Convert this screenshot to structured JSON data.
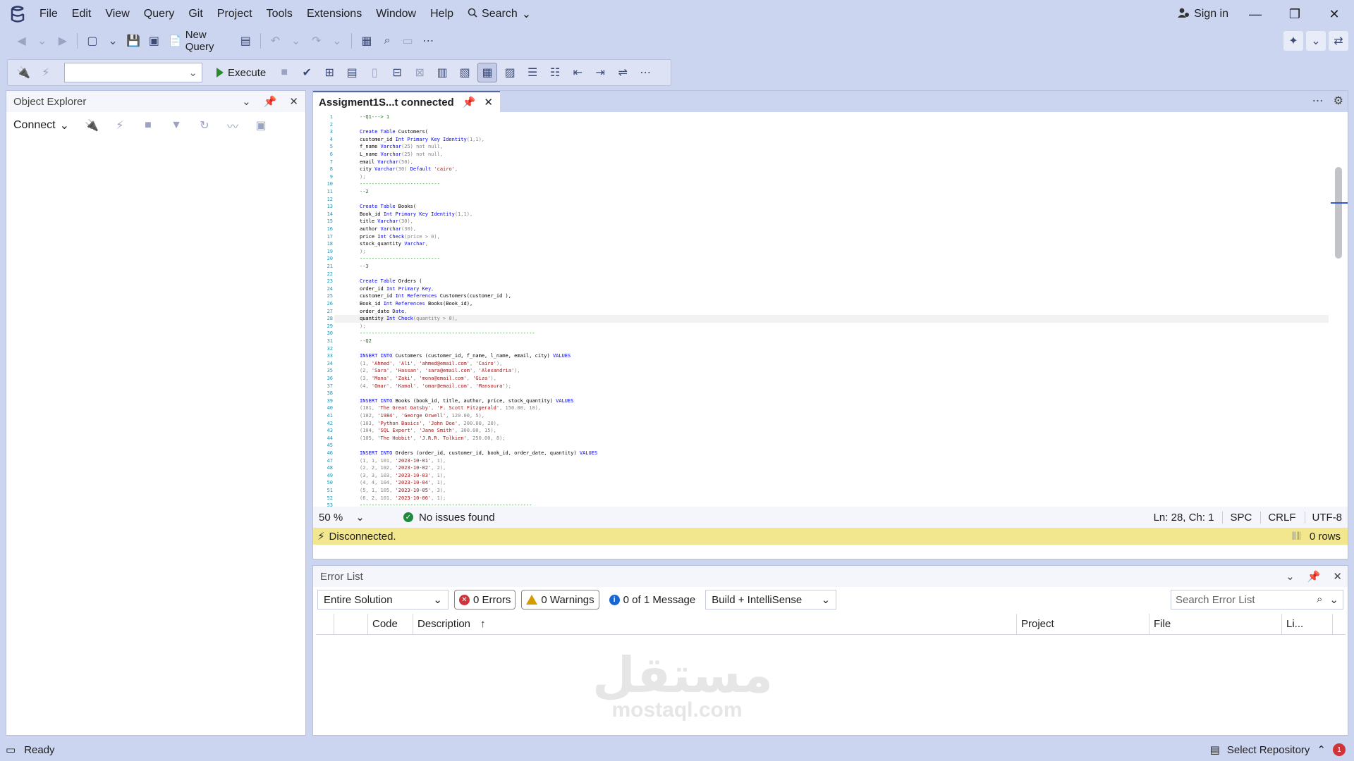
{
  "menu": {
    "items": [
      "File",
      "Edit",
      "View",
      "Query",
      "Git",
      "Project",
      "Tools",
      "Extensions",
      "Window",
      "Help"
    ],
    "search_label": "Search",
    "sign_in_label": "Sign in"
  },
  "toolbar": {
    "new_query_label": "New Query",
    "execute_label": "Execute",
    "database_value": ""
  },
  "object_explorer": {
    "title": "Object Explorer",
    "connect_label": "Connect"
  },
  "editor": {
    "tab_title": "Assigment1S...t connected",
    "zoom": "50 %",
    "issues": "No issues found",
    "position": "Ln: 28, Ch: 1",
    "whitespace": "SPC",
    "line_ending": "CRLF",
    "encoding": "UTF-8",
    "connection_status": "Disconnected.",
    "rows": "0 rows",
    "current_line": 28,
    "lines": [
      [
        [
          "c",
          "--Q1---> 1"
        ]
      ],
      [],
      [
        [
          "k",
          "Create Table "
        ],
        [
          "t",
          "Customers("
        ]
      ],
      [
        [
          "t",
          "customer_id "
        ],
        [
          "k",
          "Int Primary Key Identity"
        ],
        [
          "g",
          "(1,1),"
        ]
      ],
      [
        [
          "t",
          "f_name "
        ],
        [
          "k",
          "Varchar"
        ],
        [
          "g",
          "(25) not null,"
        ]
      ],
      [
        [
          "t",
          "L_name "
        ],
        [
          "k",
          "Varchar"
        ],
        [
          "g",
          "(25) not null,"
        ]
      ],
      [
        [
          "t",
          "email "
        ],
        [
          "k",
          "Varchar"
        ],
        [
          "g",
          "(50),"
        ]
      ],
      [
        [
          "t",
          "city "
        ],
        [
          "k",
          "Varchar"
        ],
        [
          "g",
          "(30) "
        ],
        [
          "k",
          "Default "
        ],
        [
          "s",
          "'cairo'"
        ],
        [
          "g",
          ","
        ]
      ],
      [
        [
          "g",
          ");"
        ]
      ],
      [
        [
          "c",
          "---------------------------"
        ]
      ],
      [
        [
          "c",
          "--2"
        ]
      ],
      [],
      [
        [
          "k",
          "Create Table "
        ],
        [
          "t",
          "Books("
        ]
      ],
      [
        [
          "t",
          "Book_id "
        ],
        [
          "k",
          "Int Primary Key Identity"
        ],
        [
          "g",
          "(1,1),"
        ]
      ],
      [
        [
          "t",
          "title "
        ],
        [
          "k",
          "Varchar"
        ],
        [
          "g",
          "(30),"
        ]
      ],
      [
        [
          "t",
          "author "
        ],
        [
          "k",
          "Varchar"
        ],
        [
          "g",
          "(30),"
        ]
      ],
      [
        [
          "t",
          "price "
        ],
        [
          "k",
          "Int Check"
        ],
        [
          "g",
          "(price > 0),"
        ]
      ],
      [
        [
          "t",
          "stock_quantity "
        ],
        [
          "k",
          "Varchar"
        ],
        [
          "g",
          ","
        ]
      ],
      [
        [
          "g",
          ");"
        ]
      ],
      [
        [
          "c",
          "---------------------------"
        ]
      ],
      [
        [
          "c",
          "--3"
        ]
      ],
      [],
      [
        [
          "k",
          "Create Table "
        ],
        [
          "t",
          "Orders ("
        ]
      ],
      [
        [
          "t",
          "order_id "
        ],
        [
          "k",
          "Int Primary Key"
        ],
        [
          "g",
          ","
        ]
      ],
      [
        [
          "t",
          "customer_id "
        ],
        [
          "k",
          "Int References "
        ],
        [
          "t",
          "Customers(customer_id ),"
        ]
      ],
      [
        [
          "t",
          "Book_id "
        ],
        [
          "k",
          "Int References "
        ],
        [
          "t",
          "Books(Book_id),"
        ]
      ],
      [
        [
          "t",
          "order_date "
        ],
        [
          "k",
          "Date"
        ],
        [
          "g",
          ","
        ]
      ],
      [
        [
          "t",
          "quantity "
        ],
        [
          "k",
          "Int Check"
        ],
        [
          "g",
          "(quantity > 0),"
        ]
      ],
      [
        [
          "g",
          ");"
        ]
      ],
      [
        [
          "c",
          "-----------------------------------------------------------"
        ]
      ],
      [
        [
          "c",
          "--Q2"
        ]
      ],
      [],
      [
        [
          "k",
          "INSERT INTO "
        ],
        [
          "t",
          "Customers (customer_id, f_name, l_name, email, city) "
        ],
        [
          "k",
          "VALUES"
        ]
      ],
      [
        [
          "g",
          "(1, "
        ],
        [
          "s",
          "'Ahmed'"
        ],
        [
          "g",
          ", "
        ],
        [
          "s",
          "'Ali'"
        ],
        [
          "g",
          ", "
        ],
        [
          "s",
          "'ahmed@email.com'"
        ],
        [
          "g",
          ", "
        ],
        [
          "s",
          "'Cairo'"
        ],
        [
          "g",
          "),"
        ]
      ],
      [
        [
          "g",
          "(2, "
        ],
        [
          "s",
          "'Sara'"
        ],
        [
          "g",
          ", "
        ],
        [
          "s",
          "'Hassan'"
        ],
        [
          "g",
          ", "
        ],
        [
          "s",
          "'sara@email.com'"
        ],
        [
          "g",
          ", "
        ],
        [
          "s",
          "'Alexandria'"
        ],
        [
          "g",
          "),"
        ]
      ],
      [
        [
          "g",
          "(3, "
        ],
        [
          "s",
          "'Mona'"
        ],
        [
          "g",
          ", "
        ],
        [
          "s",
          "'Zaki'"
        ],
        [
          "g",
          ", "
        ],
        [
          "s",
          "'mona@email.com'"
        ],
        [
          "g",
          ", "
        ],
        [
          "s",
          "'Giza'"
        ],
        [
          "g",
          "),"
        ]
      ],
      [
        [
          "g",
          "(4, "
        ],
        [
          "s",
          "'Omar'"
        ],
        [
          "g",
          ", "
        ],
        [
          "s",
          "'Kamal'"
        ],
        [
          "g",
          ", "
        ],
        [
          "s",
          "'omar@email.com'"
        ],
        [
          "g",
          ", "
        ],
        [
          "s",
          "'Mansoura'"
        ],
        [
          "g",
          ");"
        ]
      ],
      [],
      [
        [
          "k",
          "INSERT INTO "
        ],
        [
          "t",
          "Books (book_id, title, author, price, stock_quantity) "
        ],
        [
          "k",
          "VALUES"
        ]
      ],
      [
        [
          "g",
          "(101, "
        ],
        [
          "s",
          "'The Great Gatsby'"
        ],
        [
          "g",
          ", "
        ],
        [
          "s",
          "'F. Scott Fitzgerald'"
        ],
        [
          "g",
          ", 150.00, 10),"
        ]
      ],
      [
        [
          "g",
          "(102, "
        ],
        [
          "s",
          "'1984'"
        ],
        [
          "g",
          ", "
        ],
        [
          "s",
          "'George Orwell'"
        ],
        [
          "g",
          ", 120.00, 5),"
        ]
      ],
      [
        [
          "g",
          "(103, "
        ],
        [
          "s",
          "'Python Basics'"
        ],
        [
          "g",
          ", "
        ],
        [
          "s",
          "'John Doe'"
        ],
        [
          "g",
          ", 200.00, 20),"
        ]
      ],
      [
        [
          "g",
          "(104, "
        ],
        [
          "s",
          "'SQL Expert'"
        ],
        [
          "g",
          ", "
        ],
        [
          "s",
          "'Jane Smith'"
        ],
        [
          "g",
          ", 300.00, 15),"
        ]
      ],
      [
        [
          "g",
          "(105, "
        ],
        [
          "s",
          "'The Hobbit'"
        ],
        [
          "g",
          ", "
        ],
        [
          "s",
          "'J.R.R. Tolkien'"
        ],
        [
          "g",
          ", 250.00, 8);"
        ]
      ],
      [],
      [
        [
          "k",
          "INSERT INTO "
        ],
        [
          "t",
          "Orders (order_id, customer_id, book_id, order_date, quantity) "
        ],
        [
          "k",
          "VALUES"
        ]
      ],
      [
        [
          "g",
          "(1, 1, 101, "
        ],
        [
          "s",
          "'2023-10-01'"
        ],
        [
          "g",
          ", 1),"
        ]
      ],
      [
        [
          "g",
          "(2, 2, 102, "
        ],
        [
          "s",
          "'2023-10-02'"
        ],
        [
          "g",
          ", 2),"
        ]
      ],
      [
        [
          "g",
          "(3, 3, 103, "
        ],
        [
          "s",
          "'2023-10-03'"
        ],
        [
          "g",
          ", 1),"
        ]
      ],
      [
        [
          "g",
          "(4, 4, 104, "
        ],
        [
          "s",
          "'2023-10-04'"
        ],
        [
          "g",
          ", 1),"
        ]
      ],
      [
        [
          "g",
          "(5, 1, 105, "
        ],
        [
          "s",
          "'2023-10-05'"
        ],
        [
          "g",
          ", 3),"
        ]
      ],
      [
        [
          "g",
          "(6, 2, 101, "
        ],
        [
          "s",
          "'2023-10-06'"
        ],
        [
          "g",
          ", 1);"
        ]
      ],
      [
        [
          "c",
          "----------------------------------------------------------"
        ]
      ]
    ]
  },
  "error_list": {
    "title": "Error List",
    "scope": "Entire Solution",
    "errors": "0 Errors",
    "warnings": "0 Warnings",
    "messages": "0 of 1 Message",
    "source": "Build + IntelliSense",
    "search_placeholder": "Search Error List",
    "columns": [
      "Code",
      "Description",
      "Project",
      "File",
      "Li..."
    ]
  },
  "watermark": {
    "text": "مستقل",
    "sub": "mostaql.com"
  },
  "status": {
    "ready": "Ready",
    "repository": "Select Repository",
    "notifications": "1"
  }
}
